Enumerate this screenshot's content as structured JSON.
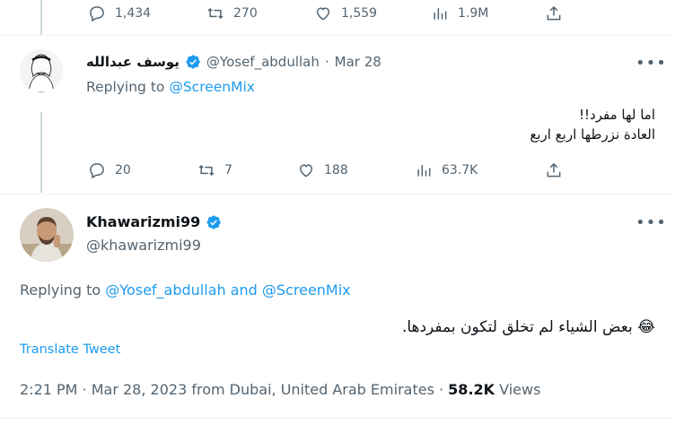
{
  "top_tweet_actions": {
    "replies": "1,434",
    "retweets": "270",
    "likes": "1,559",
    "views": "1.9M"
  },
  "reply1": {
    "display_name": "يوسف عبدالله",
    "handle": "@Yosef_abdullah",
    "dot": "·",
    "date": "Mar 28",
    "replying_prefix": "Replying to",
    "replying_to": "@ScreenMix",
    "text_line1": "اما لها مفرد!!",
    "text_line2": "العادة نزرطها اربع اربع",
    "replies": "20",
    "retweets": "7",
    "likes": "188",
    "views": "63.7K"
  },
  "main_tweet": {
    "display_name": "Khawarizmi99",
    "handle": "@khawarizmi99",
    "replying_prefix": "Replying to",
    "replying_to": "@Yosef_abdullah and @ScreenMix",
    "text": "بعض الشياء لم تخلق لتكون بمفردها.",
    "emoji": "😂",
    "translate_label": "Translate Tweet",
    "timestamp": "2:21 PM · Mar 28, 2023 from Dubai, United Arab Emirates ·",
    "views_count": "58.2K",
    "views_label": "Views"
  },
  "colors": {
    "accent": "#1d9bf0",
    "muted": "#536471",
    "text": "#0f1419",
    "separator": "#eff3f4"
  },
  "icons": [
    "reply-icon",
    "retweet-icon",
    "like-icon",
    "views-icon",
    "share-icon",
    "verified-icon",
    "more-icon"
  ]
}
